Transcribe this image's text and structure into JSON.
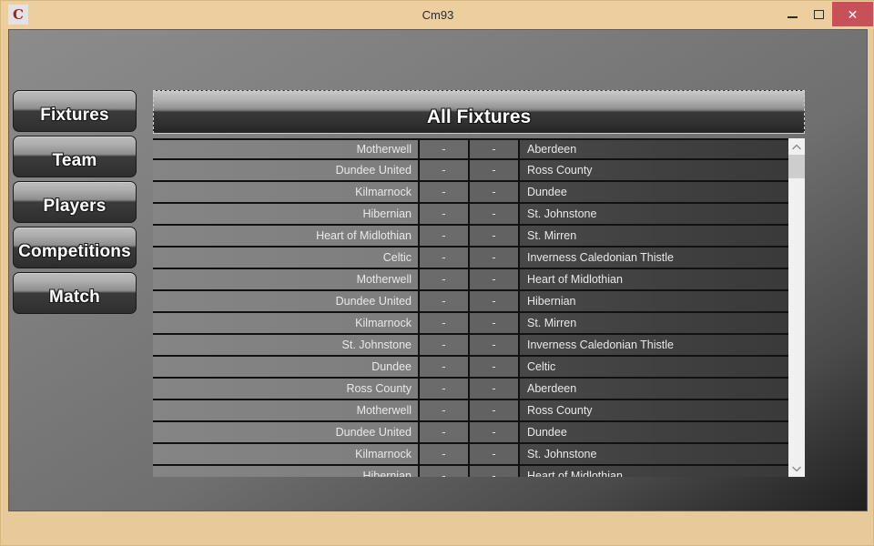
{
  "window": {
    "title": "Cm93",
    "app_icon_letter": "C",
    "app_icon_name": "cm93-app-icon",
    "controls": {
      "minimize_label": "–",
      "maximize_label": "□",
      "close_label": "✕"
    },
    "accent_close_color": "#c85058",
    "frame_color": "#ecce9f"
  },
  "sidebar": {
    "items": [
      {
        "label": "Fixtures",
        "name": "fixtures"
      },
      {
        "label": "Team",
        "name": "team"
      },
      {
        "label": "Players",
        "name": "players"
      },
      {
        "label": "Competitions",
        "name": "competitions"
      },
      {
        "label": "Match",
        "name": "match"
      }
    ]
  },
  "main": {
    "panel_title": "All Fixtures",
    "columns": [
      "Home",
      "Score1",
      "Score2",
      "Away"
    ],
    "score_placeholder": "-",
    "fixtures": [
      {
        "home": "Motherwell",
        "s1": "-",
        "s2": "-",
        "away": "Aberdeen"
      },
      {
        "home": "Dundee United",
        "s1": "-",
        "s2": "-",
        "away": "Ross County"
      },
      {
        "home": "Kilmarnock",
        "s1": "-",
        "s2": "-",
        "away": "Dundee"
      },
      {
        "home": "Hibernian",
        "s1": "-",
        "s2": "-",
        "away": "St. Johnstone"
      },
      {
        "home": "Heart of Midlothian",
        "s1": "-",
        "s2": "-",
        "away": "St. Mirren"
      },
      {
        "home": "Celtic",
        "s1": "-",
        "s2": "-",
        "away": "Inverness Caledonian Thistle"
      },
      {
        "home": "Motherwell",
        "s1": "-",
        "s2": "-",
        "away": "Heart of Midlothian"
      },
      {
        "home": "Dundee United",
        "s1": "-",
        "s2": "-",
        "away": "Hibernian"
      },
      {
        "home": "Kilmarnock",
        "s1": "-",
        "s2": "-",
        "away": "St. Mirren"
      },
      {
        "home": "St. Johnstone",
        "s1": "-",
        "s2": "-",
        "away": "Inverness Caledonian Thistle"
      },
      {
        "home": "Dundee",
        "s1": "-",
        "s2": "-",
        "away": "Celtic"
      },
      {
        "home": "Ross County",
        "s1": "-",
        "s2": "-",
        "away": "Aberdeen"
      },
      {
        "home": "Motherwell",
        "s1": "-",
        "s2": "-",
        "away": "Ross County"
      },
      {
        "home": "Dundee United",
        "s1": "-",
        "s2": "-",
        "away": "Dundee"
      },
      {
        "home": "Kilmarnock",
        "s1": "-",
        "s2": "-",
        "away": "St. Johnstone"
      },
      {
        "home": "Hibernian",
        "s1": "-",
        "s2": "-",
        "away": "Heart of Midlothian"
      }
    ]
  },
  "scrollbar": {
    "up_arrow_name": "chevron-up-icon",
    "down_arrow_name": "chevron-down-icon"
  }
}
